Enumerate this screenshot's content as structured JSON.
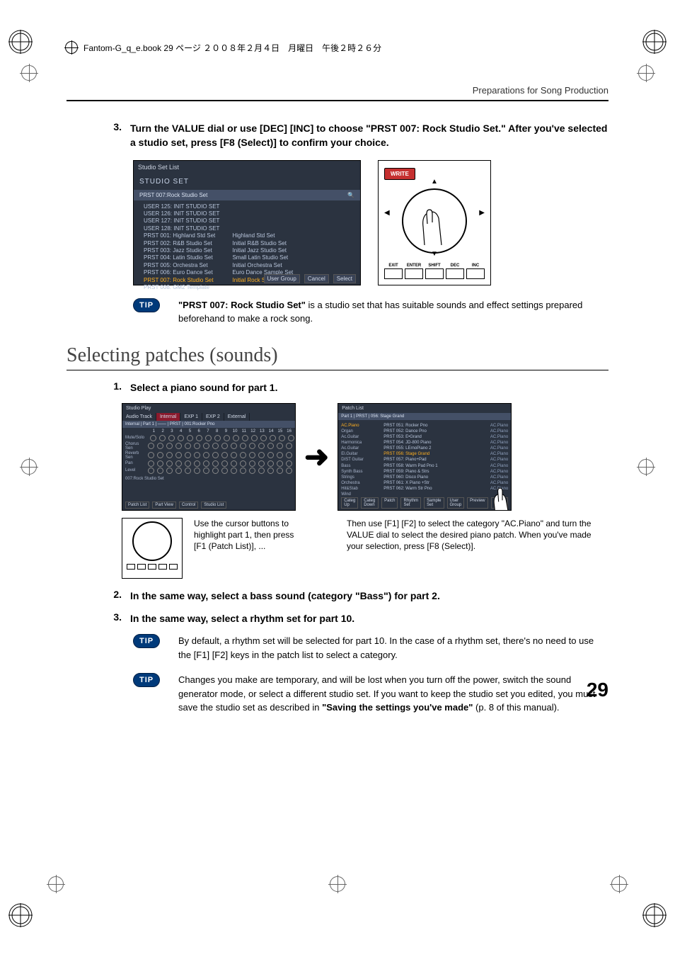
{
  "meta": {
    "book_line": "Fantom-G_q_e.book 29 ページ ２００８年２月４日　月曜日　午後２時２６分",
    "header_right": "Preparations for Song Production"
  },
  "step3": {
    "num": "3.",
    "text_a": "Turn the VALUE dial or use [DEC] [INC] to choose \"PRST 007: Rock Studio Set.\" After you've selected a studio set, press [F8 (Select)] to confirm your choice."
  },
  "ss1": {
    "title_bar": "Studio Set List",
    "shelf": "STUDIO SET",
    "selected": "PRST  007:Rock Studio Set",
    "left": [
      "USER 125: INIT STUDIO SET",
      "USER 126: INIT STUDIO SET",
      "USER 127: INIT STUDIO SET",
      "USER 128: INIT STUDIO SET",
      "PRST 001: Highland Std Set",
      "PRST 002: R&B Studio Set",
      "PRST 003: Jazz Studio Set",
      "PRST 004: Latin Studio Set",
      "PRST 005: Orchestra Set",
      "PRST 006: Euro Dance Set",
      "PRST 007: Rock Studio Set",
      "PRST 008: GM2 Template"
    ],
    "right": [
      "",
      "",
      "",
      "",
      "Highland Std Set",
      "Initial R&B Studio Set",
      "Initial Jazz Studio Set",
      "Small Latin Studio Set",
      "Initial Orchestra Set",
      "Euro Dance Sample Set",
      "Initial Rock Studio Set",
      ""
    ],
    "hl_index": "10",
    "foot": [
      "User Group",
      "Cancel",
      "Select"
    ]
  },
  "jog": {
    "write": "WRITE",
    "buttons": [
      "EXIT",
      "ENTER",
      "SHIFT",
      "DEC",
      "INC"
    ]
  },
  "tip1": {
    "label": "TIP",
    "bold": "\"PRST 007: Rock Studio Set\"",
    "rest": " is a studio set that has suitable sounds and effect settings prepared beforehand to make a rock song."
  },
  "section_heading": "Selecting patches (sounds)",
  "step1": {
    "num": "1.",
    "text": "Select a piano sound for part 1."
  },
  "ss2": {
    "title": "Studio Play",
    "tabs": [
      "Audio Track",
      "Internal",
      "EXP 1",
      "EXP 2",
      "External"
    ],
    "row_labels": [
      "Mute/Solo",
      "Chorus Sen",
      "Reverb Sen",
      "Pan",
      "Level"
    ],
    "part_nums": [
      "1",
      "2",
      "3",
      "4",
      "5",
      "6",
      "7",
      "8",
      "9",
      "10",
      "11",
      "12",
      "13",
      "14",
      "15",
      "16"
    ],
    "info": "Internal | Part 1 | —— | PRST | 001:Rocker Pno",
    "bottom_label": "007:Rock Studio Set",
    "foot": [
      "Patch List",
      "Part View",
      "Control",
      "Studio List"
    ]
  },
  "ss3": {
    "title": "Patch List",
    "header": "Part 1 | PRST | 056: Stage Grand",
    "cats": [
      "AC.Piano",
      "Organ",
      "Ac.Guitar",
      "Harmonica",
      "Ac.Guitar",
      "El.Guitar",
      "DIST Guitar",
      "Bass",
      "Synth Bass",
      "Strings",
      "Orchestra",
      "Hit&Stab",
      "Wind"
    ],
    "cat_sel": "0",
    "items": [
      {
        "id": "PRST",
        "n": "051: Rocker Pno",
        "c": "AC.Piano"
      },
      {
        "id": "PRST",
        "n": "052: Dance Pno",
        "c": "AC.Piano"
      },
      {
        "id": "PRST",
        "n": "053: E•Grand",
        "c": "AC.Piano"
      },
      {
        "id": "PRST",
        "n": "054: JD-800 Piano",
        "c": "AC.Piano"
      },
      {
        "id": "PRST",
        "n": "055: LErnoPiano 2",
        "c": "AC.Piano"
      },
      {
        "id": "PRST",
        "n": "056: Stage Grand",
        "c": "AC.Piano"
      },
      {
        "id": "PRST",
        "n": "057: Piano+Pad",
        "c": "AC.Piano"
      },
      {
        "id": "PRST",
        "n": "058: Warm Pad Pno 1",
        "c": "AC.Piano"
      },
      {
        "id": "PRST",
        "n": "059: Piano & Strs",
        "c": "AC.Piano"
      },
      {
        "id": "PRST",
        "n": "060: Disco Piano",
        "c": "AC.Piano"
      },
      {
        "id": "PRST",
        "n": "061: X Piano +Str",
        "c": "AC.Piano"
      },
      {
        "id": "PRST",
        "n": "062: Warm Str Pno",
        "c": "AC.Piano"
      }
    ],
    "item_sel": "5",
    "foot": [
      "Categ Up",
      "Categ Down",
      "Patch",
      "Rhythm Set",
      "Sample Set",
      "User Group",
      "Preview",
      "Select"
    ]
  },
  "captions": {
    "left": "Use the cursor buttons to highlight part 1, then press [F1 (Patch List)], ...",
    "right": "Then use [F1] [F2] to select the category \"AC.Piano\" and turn the VALUE dial to select the desired piano patch. When you've made your selection, press [F8 (Select)]."
  },
  "step2b": {
    "num": "2.",
    "text": "In the same way, select a bass sound (category \"Bass\") for part 2."
  },
  "step3b": {
    "num": "3.",
    "text": "In the same way, select a rhythm set for part 10."
  },
  "tip2": {
    "label": "TIP",
    "text": "By default, a rhythm set will be selected for part 10. In the case of a rhythm set, there's no need to use the [F1] [F2] keys in the patch list to select a category."
  },
  "tip3": {
    "label": "TIP",
    "text_a": "Changes you make are temporary, and will be lost when you turn off the power, switch the sound generator mode, or select a different studio set. If you want to keep the studio set you edited, you must save the studio set as described in ",
    "bold": "\"Saving the settings you've made\"",
    "text_b": " (p. 8 of this manual)."
  },
  "page_number": "29",
  "arrow": "➜"
}
